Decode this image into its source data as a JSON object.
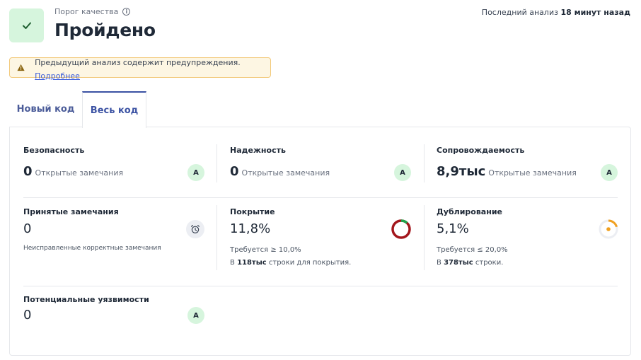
{
  "quality_gate": {
    "label": "Порог качества",
    "status": "Пройдено"
  },
  "last_analysis": {
    "prefix": "Последний анализ",
    "value": "18 минут назад"
  },
  "warning": {
    "text": "Предыдущий анализ содержит предупреждения.",
    "link": "Подробнее"
  },
  "tabs": [
    {
      "label": "Новый код"
    },
    {
      "label": "Весь код"
    }
  ],
  "metrics": {
    "security": {
      "title": "Безопасность",
      "value": "0",
      "sub": "Открытые замечания",
      "grade": "A"
    },
    "reliability": {
      "title": "Надежность",
      "value": "0",
      "sub": "Открытые замечания",
      "grade": "A"
    },
    "maintainability": {
      "title": "Сопровождаемость",
      "value": "8,9тыс",
      "sub": "Открытые замечания",
      "grade": "A"
    },
    "accepted": {
      "title": "Принятые замечания",
      "value": "0",
      "note": "Неисправленные корректные замечания"
    },
    "coverage": {
      "title": "Покрытие",
      "value": "11,8%",
      "required": "Требуется ≥ 10,0%",
      "lines_prefix": "В",
      "lines_value": "118тыс",
      "lines_suffix": "строки для покрытия.",
      "percent": 11.8
    },
    "duplication": {
      "title": "Дублирование",
      "value": "5,1%",
      "required": "Требуется ≤ 20,0%",
      "lines_prefix": "В",
      "lines_value": "378тыс",
      "lines_suffix": "строки.",
      "percent": 5.1
    },
    "hotspots": {
      "title": "Потенциальные уязвимости",
      "value": "0",
      "grade": "A"
    }
  },
  "colors": {
    "success_bg": "#d6f5dd",
    "coverage_covered": "#1fa34a",
    "coverage_uncovered": "#a3161c",
    "duplication_fill": "#f0a020",
    "link": "#3a5bd9",
    "accent": "#3b52a3"
  },
  "icons": {
    "gate": "check-icon",
    "warning": "warning-triangle-icon",
    "accepted": "alarm-clock-icon"
  }
}
